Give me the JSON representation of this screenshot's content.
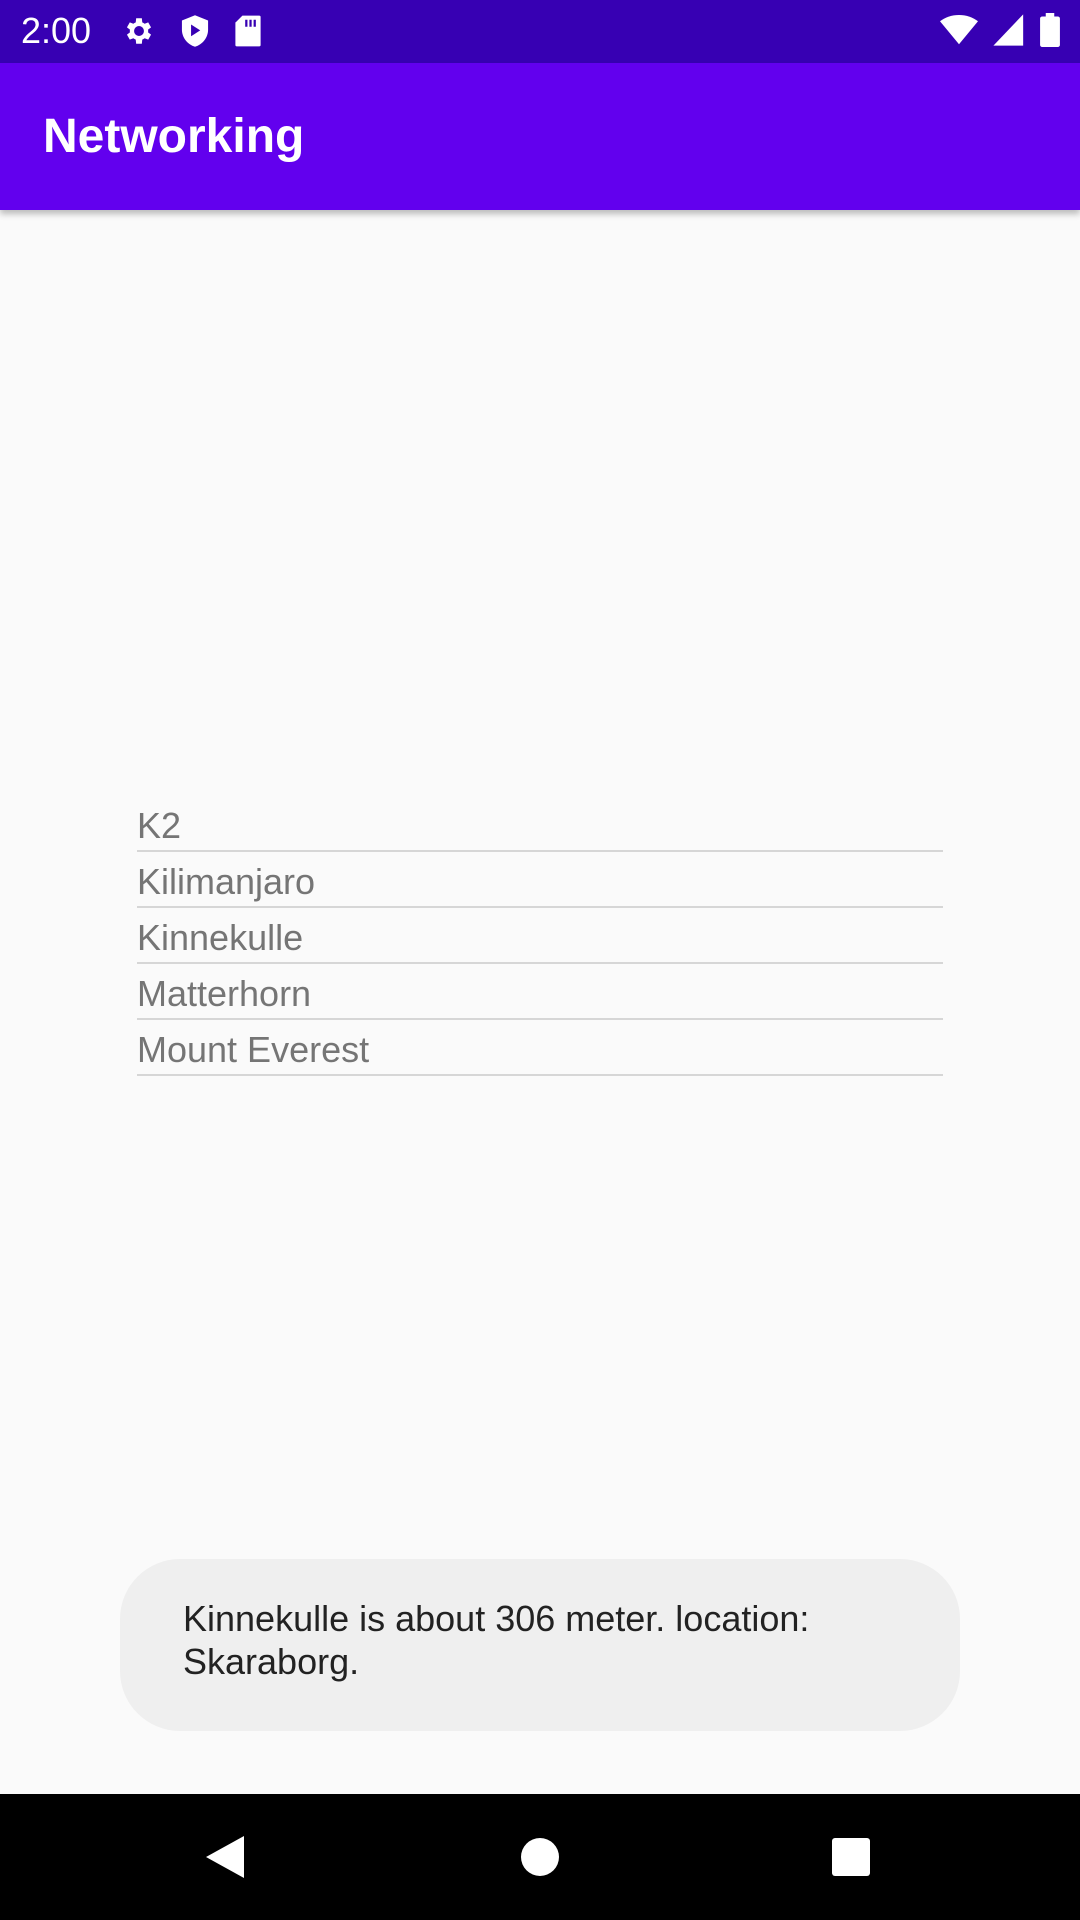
{
  "status_bar": {
    "time": "2:00",
    "left_icons": [
      "settings-icon",
      "shield-play-icon",
      "sd-card-icon"
    ],
    "right_icons": [
      "wifi-icon",
      "cell-signal-icon",
      "battery-icon"
    ],
    "color": "#3700b3"
  },
  "app_bar": {
    "title": "Networking",
    "color": "#6200ee"
  },
  "mountains": [
    {
      "label": "K2"
    },
    {
      "label": "Kilimanjaro"
    },
    {
      "label": "Kinnekulle"
    },
    {
      "label": "Matterhorn"
    },
    {
      "label": "Mount Everest"
    }
  ],
  "toast": {
    "message": "Kinnekulle is about 306 meter. location: Skaraborg."
  },
  "nav_bar": {
    "buttons": [
      "back-icon",
      "home-icon",
      "recents-icon"
    ]
  }
}
